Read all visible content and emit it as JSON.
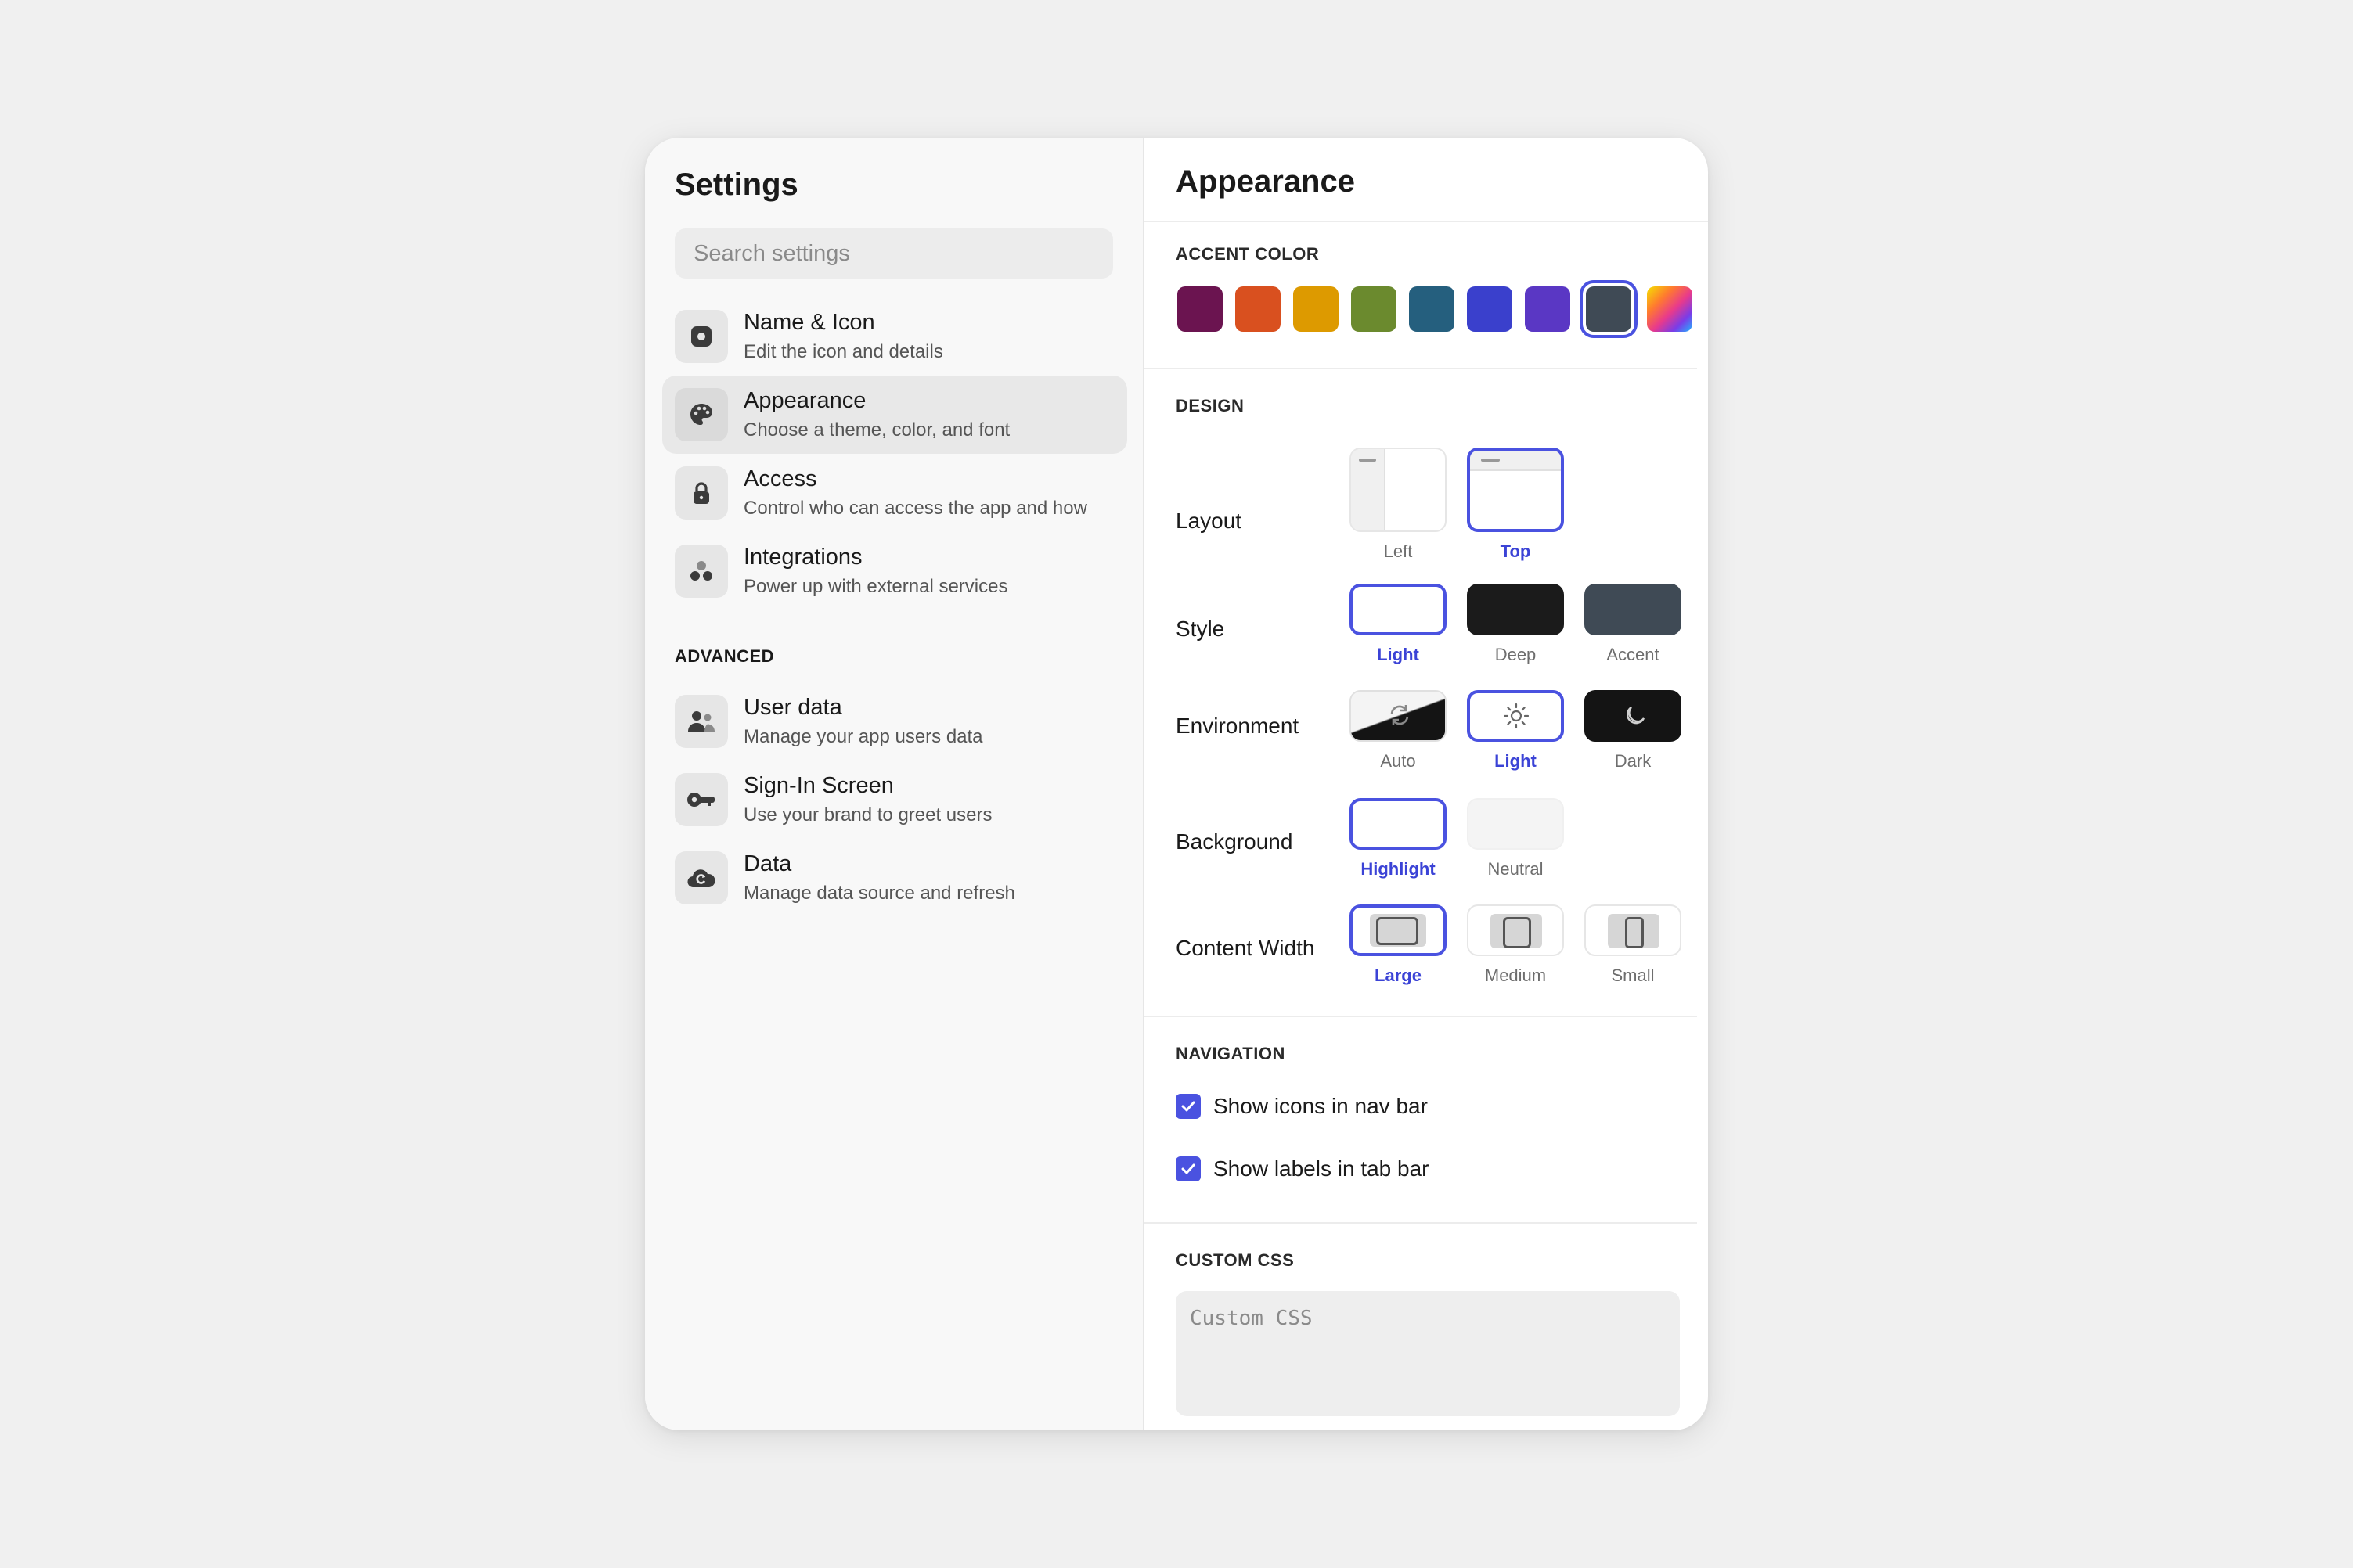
{
  "sidebar": {
    "title": "Settings",
    "search_placeholder": "Search settings",
    "items": [
      {
        "label": "Name & Icon",
        "desc": "Edit the icon and details"
      },
      {
        "label": "Appearance",
        "desc": "Choose a theme, color, and font"
      },
      {
        "label": "Access",
        "desc": "Control who can access the app and how"
      },
      {
        "label": "Integrations",
        "desc": "Power up with external services"
      }
    ],
    "advanced_heading": "ADVANCED",
    "advanced_items": [
      {
        "label": "User data",
        "desc": "Manage your app users data"
      },
      {
        "label": "Sign-In Screen",
        "desc": "Use your brand to greet users"
      },
      {
        "label": "Data",
        "desc": "Manage data source and refresh"
      }
    ]
  },
  "main": {
    "title": "Appearance",
    "accent": {
      "heading": "ACCENT COLOR",
      "colors": [
        "#6b1450",
        "#d9501f",
        "#dd9a00",
        "#6b8a2e",
        "#255f7e",
        "#3a40cc",
        "#5a37c4",
        "#3f4a55"
      ],
      "selected_index": 7
    },
    "design": {
      "heading": "DESIGN",
      "layout": {
        "label": "Layout",
        "options": [
          "Left",
          "Top"
        ],
        "selected": "Top"
      },
      "style": {
        "label": "Style",
        "options": [
          "Light",
          "Deep",
          "Accent"
        ],
        "selected": "Light"
      },
      "environment": {
        "label": "Environment",
        "options": [
          "Auto",
          "Light",
          "Dark"
        ],
        "selected": "Light"
      },
      "background": {
        "label": "Background",
        "options": [
          "Highlight",
          "Neutral"
        ],
        "selected": "Highlight"
      },
      "content_width": {
        "label": "Content Width",
        "options": [
          "Large",
          "Medium",
          "Small"
        ],
        "selected": "Large"
      }
    },
    "navigation": {
      "heading": "NAVIGATION",
      "show_icons": {
        "label": "Show icons in nav bar",
        "checked": true
      },
      "show_labels": {
        "label": "Show labels in tab bar",
        "checked": true
      }
    },
    "custom_css": {
      "heading": "CUSTOM CSS",
      "placeholder": "Custom CSS",
      "value": ""
    }
  }
}
